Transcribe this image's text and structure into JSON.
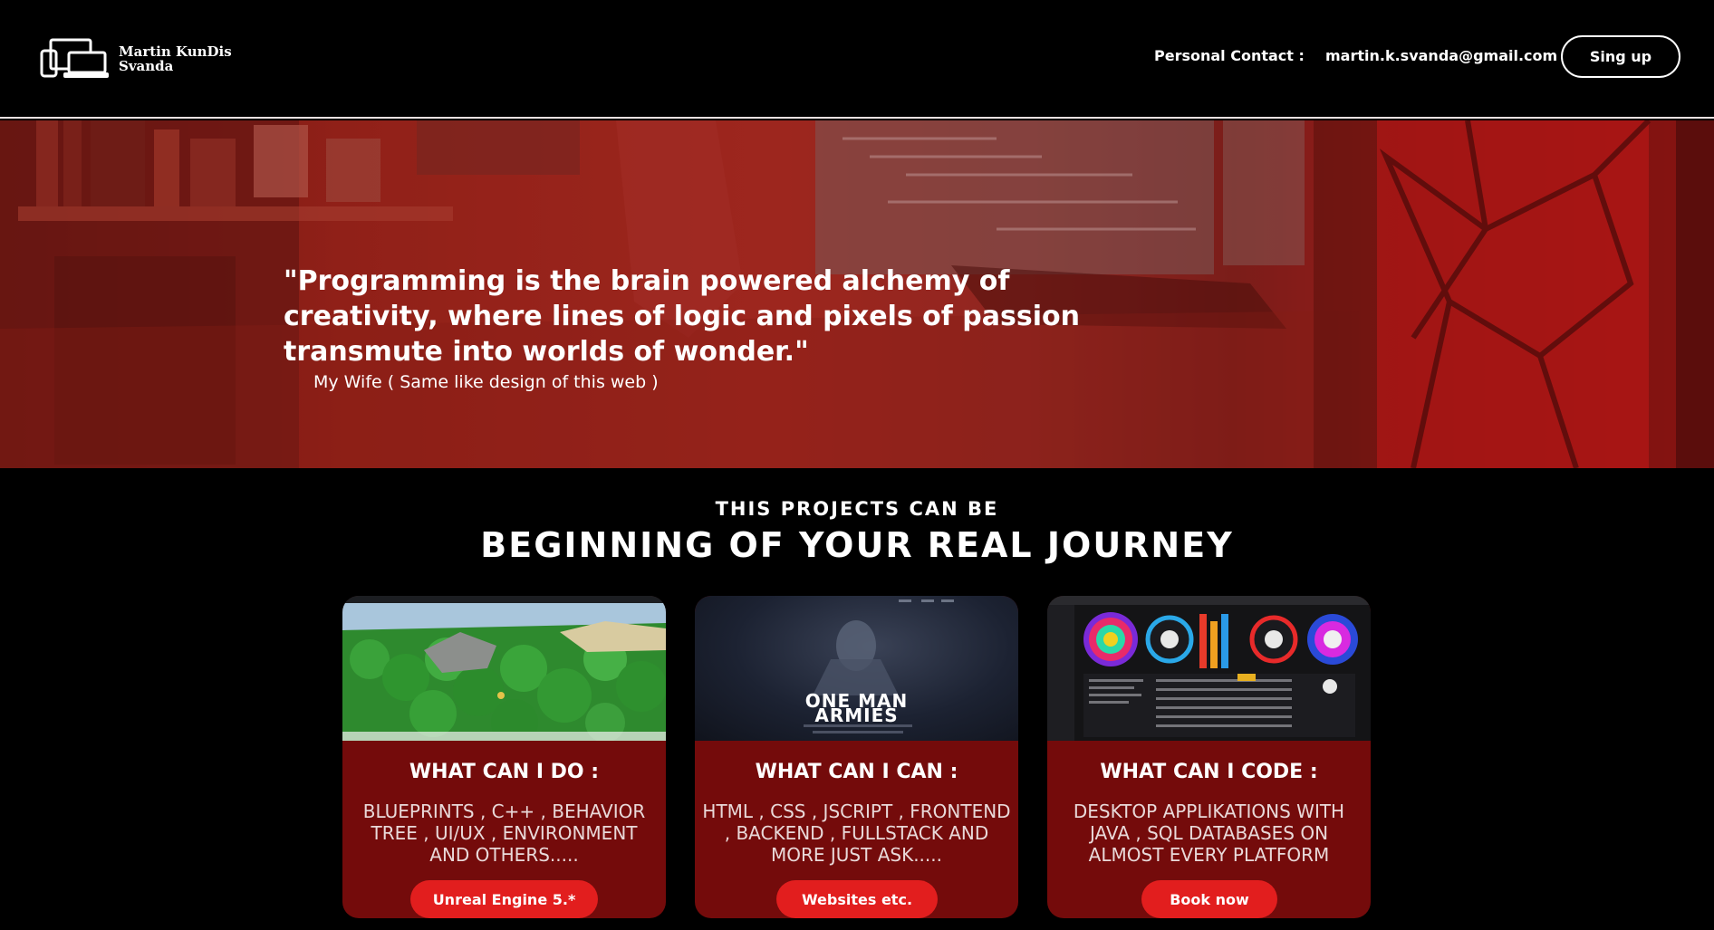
{
  "header": {
    "logo_line1": "Martin KunDis",
    "logo_line2": "Svanda",
    "contact_label": "Personal Contact :",
    "contact_email": "martin.k.svanda@gmail.com",
    "signup_label": "Sing up",
    "logo_icon": "devices-icon"
  },
  "hero": {
    "quote": "\"Programming is the brain powered alchemy of creativity, where lines of logic and pixels of passion transmute into worlds of wonder.\"",
    "author": "My Wife ( Same like design of this web )"
  },
  "section": {
    "subtitle": "THIS PROJECTS CAN BE",
    "title": "BEGINNING OF YOUR REAL JOURNEY"
  },
  "cards": [
    {
      "title": "WHAT CAN I DO :",
      "description": "BLUEPRINTS , C++ , BEHAVIOR TREE , UI/UX , ENVIRONMENT AND OTHERS.....",
      "button": "Unreal Engine 5.*"
    },
    {
      "title": "WHAT CAN I CAN :",
      "description": "HTML , CSS , JSCRIPT , FRONTEND , BACKEND , FULLSTACK AND MORE JUST ASK.....",
      "button": "Websites etc.",
      "image_text_line1": "ONE MAN",
      "image_text_line2": "ARMIES"
    },
    {
      "title": "WHAT CAN I CODE :",
      "description": "DESKTOP APPLIKATIONS WITH JAVA , SQL DATABASES ON ALMOST EVERY PLATFORM",
      "button": "Book now"
    }
  ],
  "colors": {
    "accent": "#e21e1e",
    "card_bg": "#740b0b",
    "page_bg": "#000000"
  }
}
